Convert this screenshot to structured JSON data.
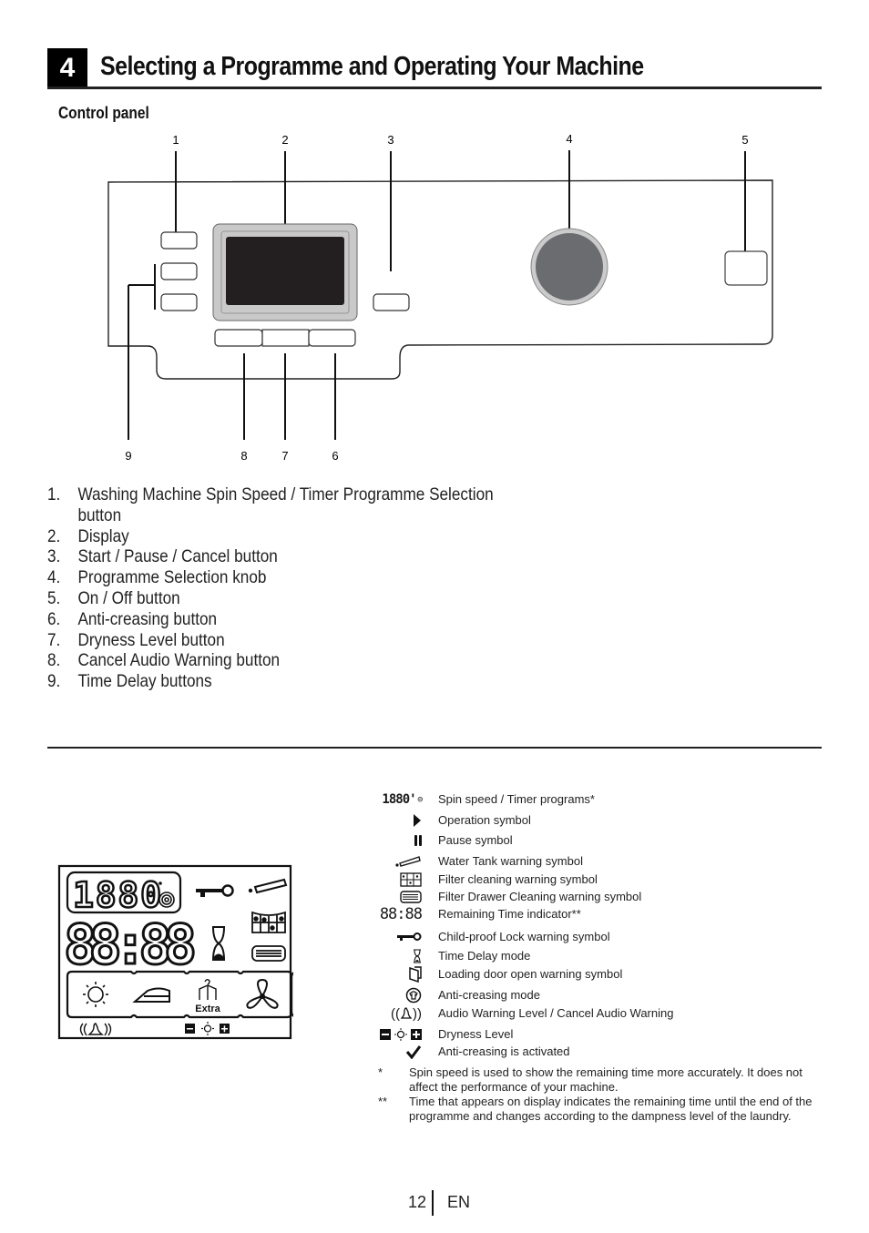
{
  "section": {
    "number": "4",
    "title": "Selecting a Programme and Operating Your Machine"
  },
  "control_panel": {
    "subtitle": "Control panel",
    "callouts": [
      "1",
      "2",
      "3",
      "4",
      "5",
      "6",
      "7",
      "8",
      "9"
    ]
  },
  "parts": [
    {
      "num": "1.",
      "label": "Washing Machine Spin Speed / Timer Programme Selection",
      "label_cont": "button"
    },
    {
      "num": "2.",
      "label": "Display"
    },
    {
      "num": "3.",
      "label": "Start / Pause / Cancel button"
    },
    {
      "num": "4.",
      "label": "Programme Selection knob"
    },
    {
      "num": "5.",
      "label": "On / Off button"
    },
    {
      "num": "6.",
      "label": "Anti-creasing button"
    },
    {
      "num": "7.",
      "label": "Dryness Level button"
    },
    {
      "num": "8.",
      "label": "Cancel Audio Warning button"
    },
    {
      "num": "9.",
      "label": "Time Delay buttons"
    }
  ],
  "lcd": {
    "spin_digits": "1880",
    "time_digits": "88:88",
    "extra_label": "Extra"
  },
  "legend": [
    {
      "icon": "spin-speed-icon",
      "text": "Spin speed / Timer programs*"
    },
    {
      "icon": "play-icon",
      "text": "Operation symbol"
    },
    {
      "icon": "pause-icon",
      "text": "Pause symbol"
    },
    {
      "icon": "water-tank-icon",
      "text": "Water Tank warning symbol"
    },
    {
      "icon": "filter-icon",
      "text": "Filter cleaning warning symbol"
    },
    {
      "icon": "filter-drawer-icon",
      "text": "Filter Drawer Cleaning warning symbol"
    },
    {
      "icon": "remaining-time-icon",
      "text": "Remaining Time indicator**"
    },
    {
      "icon": "key-icon",
      "text": "Child-proof Lock warning symbol"
    },
    {
      "icon": "hourglass-icon",
      "text": "Time Delay mode"
    },
    {
      "icon": "door-icon",
      "text": "Loading door open warning symbol"
    },
    {
      "icon": "anti-crease-icon",
      "text": "Anti-creasing mode"
    },
    {
      "icon": "bell-icon",
      "text": "Audio Warning Level / Cancel Audio Warning"
    },
    {
      "icon": "dryness-icon",
      "text": "Dryness Level"
    },
    {
      "icon": "check-icon",
      "text": "Anti-creasing is activated"
    }
  ],
  "notes": [
    {
      "mark": "*",
      "text": "Spin speed is used to show the remaining time more accurately. It does not affect the performance of your machine."
    },
    {
      "mark": "**",
      "text": "Time that appears on display indicates the remaining time until the end of the programme and changes according to the dampness level of the laundry."
    }
  ],
  "footer": {
    "page": "12",
    "lang": "EN"
  }
}
